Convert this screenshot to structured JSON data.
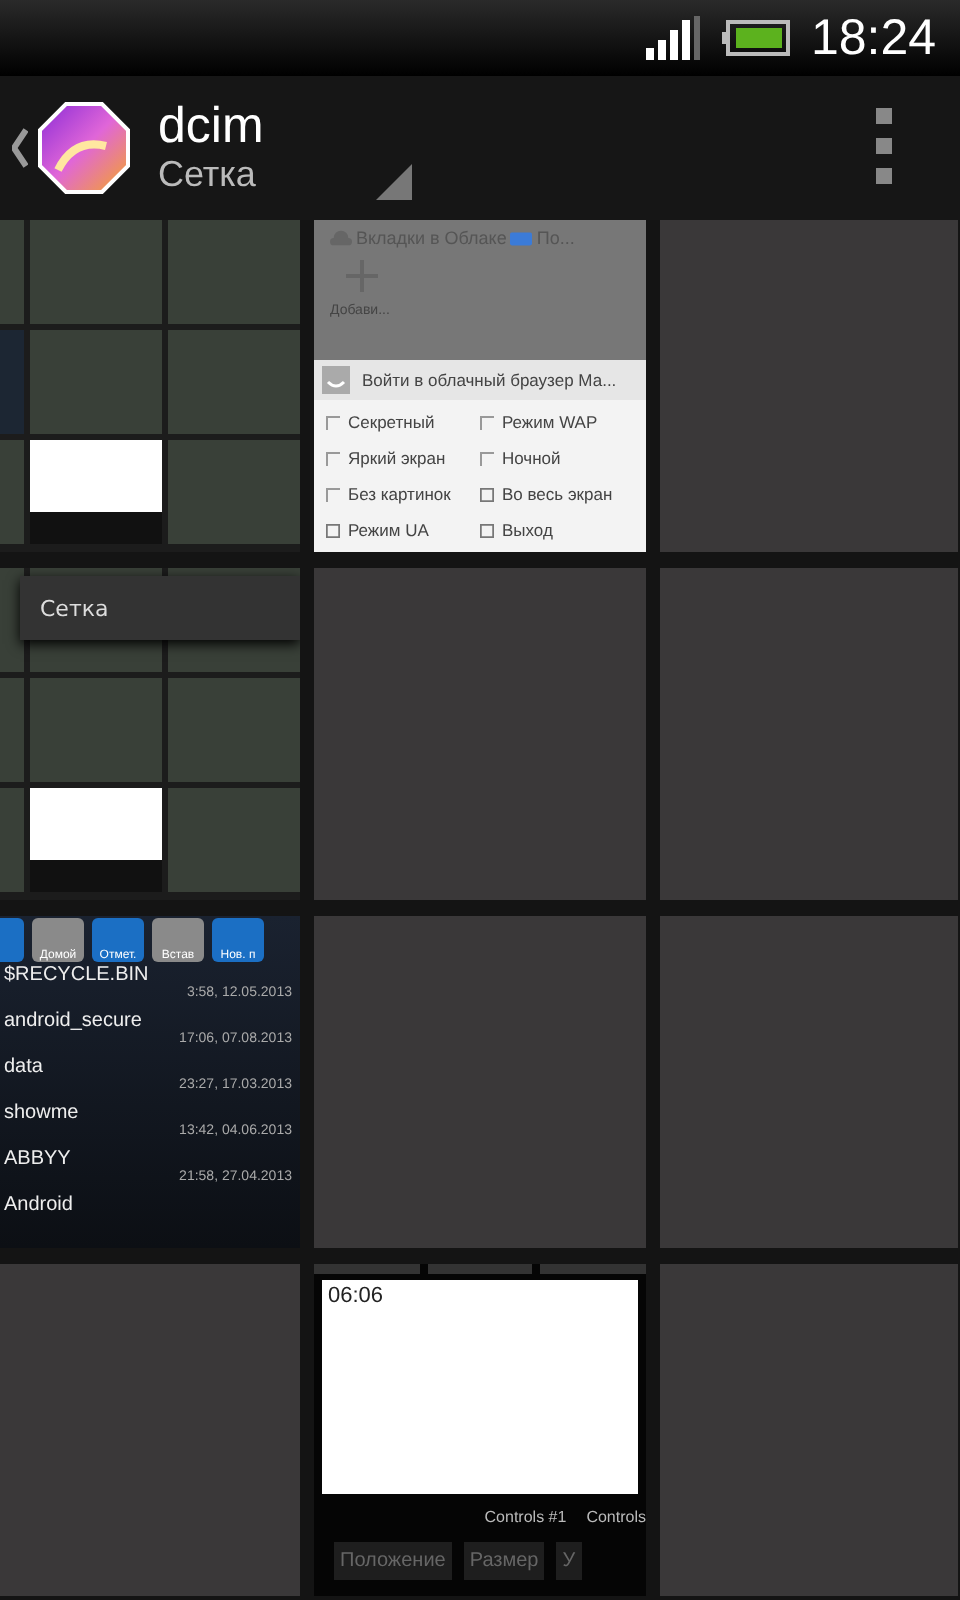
{
  "status_bar": {
    "time": "18:24"
  },
  "action_bar": {
    "title": "dcim",
    "subtitle": "Сетка"
  },
  "tiles": [
    {
      "kind": "grid-shot"
    },
    {
      "kind": "browser-menu",
      "header": "Вкладки в Облаке",
      "header_more": "По...",
      "add_label": "Добави...",
      "login": "Войти в облачный браузер Ма...",
      "options": [
        {
          "kind": "check",
          "label": "Секретный",
          "checked": false
        },
        {
          "kind": "check",
          "label": "Режим WAP",
          "checked": false
        },
        {
          "kind": "check",
          "label": "Яркий экран",
          "checked": false
        },
        {
          "kind": "check",
          "label": "Ночной",
          "checked": false
        },
        {
          "kind": "check",
          "label": "Без картинок",
          "checked": false
        },
        {
          "kind": "icon",
          "label": "Во весь экран"
        },
        {
          "kind": "icon",
          "label": "Режим UA"
        },
        {
          "kind": "icon",
          "label": "Выход"
        }
      ]
    },
    {
      "kind": "empty"
    },
    {
      "kind": "grid-popup",
      "popup": "Сетка"
    },
    {
      "kind": "empty"
    },
    {
      "kind": "empty"
    },
    {
      "kind": "file-manager",
      "buttons": [
        {
          "color": "#1b6fc4"
        },
        {
          "label": "Домой",
          "color": "#8a8a8a"
        },
        {
          "label": "Отмет.",
          "color": "#1b6fc4"
        },
        {
          "label": "Встав",
          "color": "#8a8a8a"
        },
        {
          "label": "Нов. п",
          "color": "#1b6fc4"
        }
      ],
      "files": [
        {
          "name": "$RECYCLE.BIN",
          "date": "3:58, 12.05.2013"
        },
        {
          "name": "android_secure",
          "date": "17:06, 07.08.2013"
        },
        {
          "name": "data",
          "date": "23:27, 17.03.2013"
        },
        {
          "name": "showme",
          "date": "13:42, 04.06.2013"
        },
        {
          "name": "ABBYY",
          "date": "21:58, 27.04.2013"
        },
        {
          "name": "Android"
        }
      ]
    },
    {
      "kind": "empty"
    },
    {
      "kind": "empty"
    },
    {
      "kind": "empty"
    },
    {
      "kind": "controls",
      "clock": "06:06",
      "tabs": [
        "Controls #1",
        "Controls"
      ],
      "buttons": [
        "Положение",
        "Размер",
        "У"
      ]
    },
    {
      "kind": "empty"
    }
  ]
}
